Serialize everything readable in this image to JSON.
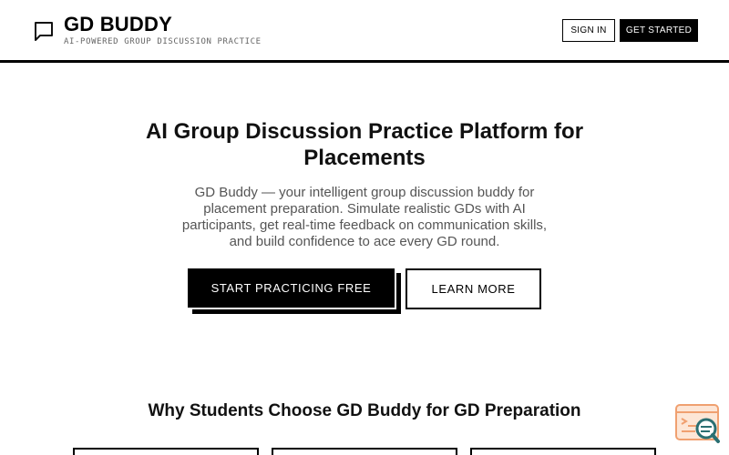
{
  "header": {
    "brand_name": "GD BUDDY",
    "brand_tagline": "AI-POWERED GROUP DISCUSSION PRACTICE",
    "logo_icon": "chat-bubble-icon",
    "sign_in_label": "SIGN IN",
    "get_started_label": "GET STARTED"
  },
  "hero": {
    "title": "AI Group Discussion Practice Platform for Placements",
    "description": "GD Buddy — your intelligent group discussion buddy for placement preparation. Simulate realistic GDs with AI participants, get real-time feedback on communication skills, and build confidence to ace every GD round.",
    "primary_cta_label": "START PRACTICING FREE",
    "secondary_cta_label": "LEARN MORE"
  },
  "features": {
    "section_title": "Why Students Choose GD Buddy for GD Preparation"
  },
  "widget": {
    "icon": "search-chat-widget-icon",
    "accent_color": "#f0a070",
    "icon_color": "#2a6f72"
  },
  "colors": {
    "primary": "#000000",
    "background": "#ffffff",
    "muted_text": "#555555"
  }
}
